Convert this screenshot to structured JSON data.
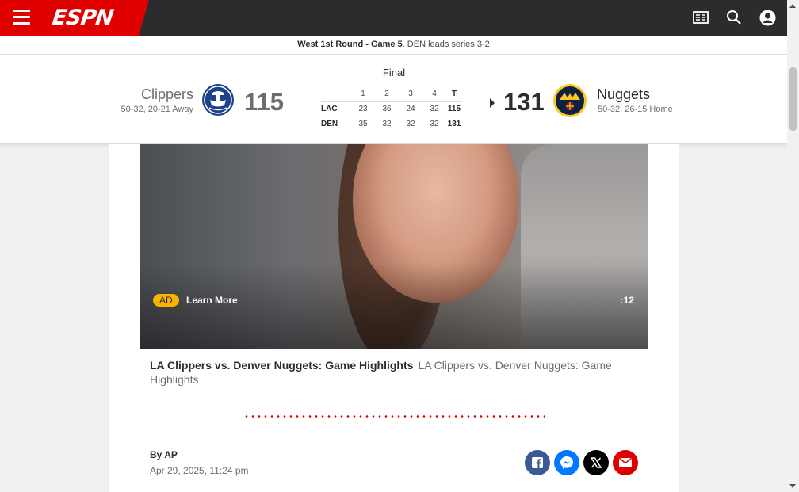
{
  "nav": {
    "logo": "ESPN",
    "icons": [
      "menu-icon",
      "scores-icon",
      "search-icon",
      "profile-icon"
    ]
  },
  "series": {
    "round": "West 1st Round - Game 5",
    "status": ". DEN leads series 3-2"
  },
  "game": {
    "status": "Final",
    "away": {
      "name": "Clippers",
      "record": "50-32, 20-21 Away",
      "score": "115",
      "abbr": "LAC",
      "quarters": [
        "23",
        "36",
        "24",
        "32"
      ],
      "total": "115"
    },
    "home": {
      "name": "Nuggets",
      "record": "50-32, 26-15 Home",
      "score": "131",
      "abbr": "DEN",
      "quarters": [
        "35",
        "32",
        "32",
        "32"
      ],
      "total": "131"
    },
    "periods": [
      "1",
      "2",
      "3",
      "4"
    ],
    "total_label": "T"
  },
  "video": {
    "ad_label": "AD",
    "learn_more": "Learn More",
    "duration": ":12"
  },
  "article": {
    "video_title": "LA Clippers vs. Denver Nuggets: Game Highlights",
    "video_desc": "LA Clippers vs. Denver Nuggets: Game Highlights",
    "byline": "By AP",
    "date": "Apr 29, 2025, 11:24 pm"
  },
  "share": [
    "facebook-icon",
    "messenger-icon",
    "x-icon",
    "email-icon"
  ],
  "colors": {
    "espn_red": "#e10000",
    "nav_bg": "#2b2c2d",
    "ad_yellow": "#f8b500"
  }
}
